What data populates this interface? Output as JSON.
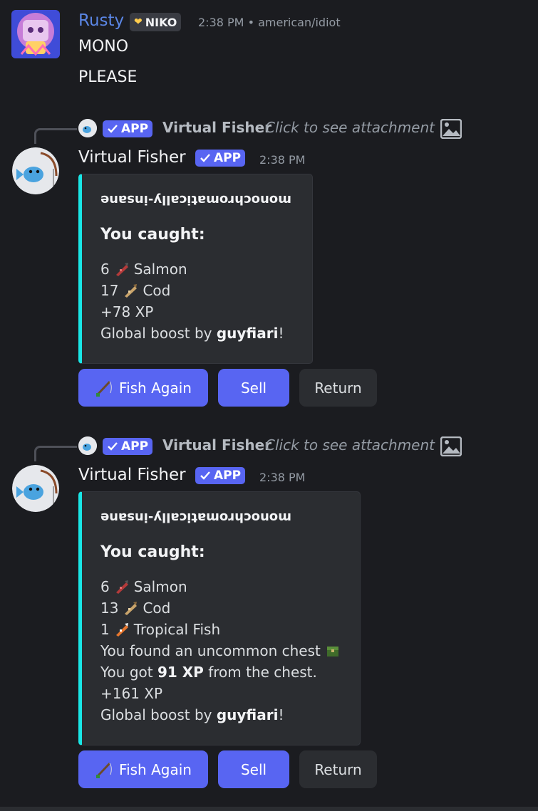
{
  "colors": {
    "background": "#1b1c20",
    "rusty_name": "#5b86e5",
    "blurple": "#5865f2",
    "embed_accent": "#19e6e6"
  },
  "message1": {
    "username": "Rusty",
    "role_tag": "NIKO",
    "timestamp": "2:38 PM",
    "separator": "•",
    "channel": "american/idiot",
    "lines": [
      "MONO",
      "PLEASE"
    ]
  },
  "replies": [
    {
      "badge": "APP",
      "reply_name": "Virtual Fisher",
      "reply_text": "Click to see attachment",
      "bot_name": "Virtual Fisher",
      "bot_badge": "APP",
      "timestamp": "2:38 PM",
      "embed": {
        "flipped_title": "monochromatically-insane",
        "caught_label": "You caught:",
        "catches": [
          {
            "count": "6",
            "name": "Salmon",
            "icon": "salmon-icon"
          },
          {
            "count": "17",
            "name": "Cod",
            "icon": "cod-icon"
          }
        ],
        "xp": "+78 XP",
        "boost_prefix": "Global boost by ",
        "boost_user": "guyfiari",
        "boost_suffix": "!"
      },
      "buttons": {
        "fish_again": "Fish Again",
        "sell": "Sell",
        "return": "Return"
      }
    },
    {
      "badge": "APP",
      "reply_name": "Virtual Fisher",
      "reply_text": "Click to see attachment",
      "bot_name": "Virtual Fisher",
      "bot_badge": "APP",
      "timestamp": "2:38 PM",
      "embed": {
        "flipped_title": "monochromatically-insane",
        "caught_label": "You caught:",
        "catches": [
          {
            "count": "6",
            "name": "Salmon",
            "icon": "salmon-icon"
          },
          {
            "count": "13",
            "name": "Cod",
            "icon": "cod-icon"
          },
          {
            "count": "1",
            "name": "Tropical Fish",
            "icon": "tropical-fish-icon"
          }
        ],
        "chest_text": "You found an uncommon chest",
        "chest_xp_prefix": "You got ",
        "chest_xp_value": "91 XP",
        "chest_xp_suffix": " from the chest.",
        "xp": "+161 XP",
        "boost_prefix": "Global boost by ",
        "boost_user": "guyfiari",
        "boost_suffix": "!"
      },
      "buttons": {
        "fish_again": "Fish Again",
        "sell": "Sell",
        "return": "Return"
      }
    }
  ]
}
